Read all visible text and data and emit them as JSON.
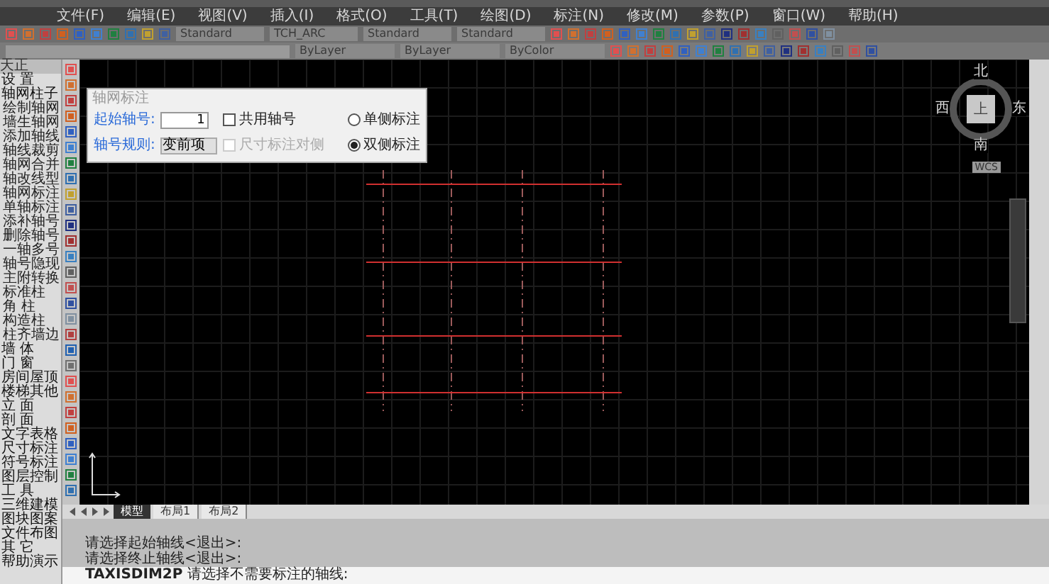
{
  "menu_bar": [
    "文件(F)",
    "编辑(E)",
    "视图(V)",
    "插入(I)",
    "格式(O)",
    "工具(T)",
    "绘图(D)",
    "标注(N)",
    "修改(M)",
    "参数(P)",
    "窗口(W)",
    "帮助(H)"
  ],
  "style_toolbar": [
    "Standard",
    "TCH_ARC",
    "Standard",
    "Standard"
  ],
  "properties_toolbar": [
    "ByLayer",
    "ByLayer",
    "ByColor"
  ],
  "sidebar": {
    "title": "天正",
    "items": [
      {
        "label": "设 置"
      },
      {
        "label": "轴网柱子",
        "children": [
          {
            "label": "绘制轴网"
          },
          {
            "label": "墙生轴网"
          },
          {
            "label": "添加轴线"
          },
          {
            "label": "轴线裁剪"
          },
          {
            "label": "轴网合并"
          },
          {
            "label": "轴改线型"
          },
          {
            "label": "轴网标注"
          },
          {
            "label": "单轴标注"
          },
          {
            "label": "添补轴号"
          },
          {
            "label": "删除轴号"
          },
          {
            "label": "一轴多号"
          },
          {
            "label": "轴号隐现"
          },
          {
            "label": "主附转换"
          },
          {
            "label": "标准柱"
          },
          {
            "label": "角 柱"
          },
          {
            "label": "构造柱"
          },
          {
            "label": "柱齐墙边"
          }
        ]
      },
      {
        "label": "墙 体"
      },
      {
        "label": "门 窗"
      },
      {
        "label": "房间屋顶"
      },
      {
        "label": "楼梯其他"
      },
      {
        "label": "立 面"
      },
      {
        "label": "剖 面"
      },
      {
        "label": "文字表格"
      },
      {
        "label": "尺寸标注"
      },
      {
        "label": "符号标注"
      },
      {
        "label": "图层控制"
      },
      {
        "label": "工 具"
      },
      {
        "label": "三维建模"
      },
      {
        "label": "图块图案"
      },
      {
        "label": "文件布图"
      },
      {
        "label": "其 它"
      },
      {
        "label": "帮助演示"
      }
    ]
  },
  "dialog": {
    "title": "轴网标注",
    "start_label": "起始轴号:",
    "start_value": "1",
    "rule_label": "轴号规则:",
    "rule_value": "变前项",
    "checkboxes": [
      {
        "label": "共用轴号",
        "checked": false,
        "disabled": false
      },
      {
        "label": "尺寸标注对侧",
        "checked": false,
        "disabled": true
      }
    ],
    "radios": [
      {
        "label": "单侧标注",
        "selected": false
      },
      {
        "label": "双侧标注",
        "selected": true
      }
    ]
  },
  "view_cube": {
    "north": "北",
    "south": "南",
    "east": "东",
    "west": "西",
    "face": "上",
    "ucs": "WCS"
  },
  "layout_tabs": [
    {
      "label": "模型",
      "selected": true
    },
    {
      "label": "布局1",
      "selected": false
    },
    {
      "label": "布局2",
      "selected": false
    }
  ],
  "command_history": [
    "请选择起始轴线<退出>:",
    "请选择终止轴线<退出>:"
  ],
  "command_line": "**TAXISDIM2P** 请选择不需要标注的轴线:"
}
